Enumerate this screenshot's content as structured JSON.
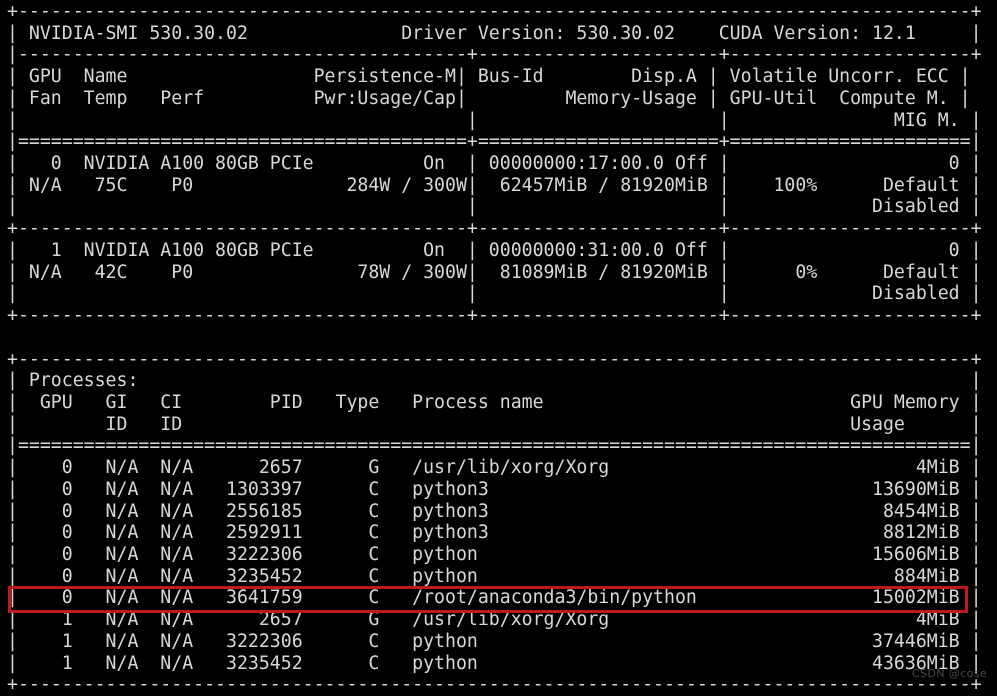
{
  "terminal": {
    "tool": "nvidia-smi",
    "background_color": "#000000",
    "text_color": "#d8d8d8",
    "highlight_color": "#bd1a1a",
    "columns": 80,
    "rows": 32
  },
  "header": {
    "smi_label": "NVIDIA-SMI",
    "smi_version": "530.30.02",
    "driver_label": "Driver Version:",
    "driver_version": "530.30.02",
    "cuda_label": "CUDA Version:",
    "cuda_version": "12.1"
  },
  "gpu_table": {
    "headers_row1": [
      "GPU",
      "Name",
      "Persistence-M",
      "Bus-Id",
      "Disp.A",
      "Volatile Uncorr. ECC"
    ],
    "headers_row2": [
      "Fan",
      "Temp",
      "Perf",
      "Pwr:Usage/Cap",
      "Memory-Usage",
      "GPU-Util",
      "Compute M."
    ],
    "headers_row3": [
      "MIG M."
    ],
    "rows": [
      {
        "index": "0",
        "name": "NVIDIA A100 80GB PCIe",
        "persistence_m": "On",
        "bus_id": "00000000:17:00.0",
        "disp_a": "Off",
        "ecc": "0",
        "fan": "N/A",
        "temp": "75C",
        "perf": "P0",
        "pwr_usage": "284W",
        "pwr_cap": "300W",
        "mem_used": "62457MiB",
        "mem_total": "81920MiB",
        "gpu_util": "100%",
        "compute_m": "Default",
        "mig_m": "Disabled"
      },
      {
        "index": "1",
        "name": "NVIDIA A100 80GB PCIe",
        "persistence_m": "On",
        "bus_id": "00000000:31:00.0",
        "disp_a": "Off",
        "ecc": "0",
        "fan": "N/A",
        "temp": "42C",
        "perf": "P0",
        "pwr_usage": "78W",
        "pwr_cap": "300W",
        "mem_used": "81089MiB",
        "mem_total": "81920MiB",
        "gpu_util": "0%",
        "compute_m": "Default",
        "mig_m": "Disabled"
      }
    ]
  },
  "processes_table": {
    "section_title": "Processes:",
    "headers_row1": [
      "GPU",
      "GI",
      "CI",
      "PID",
      "Type",
      "Process name",
      "GPU Memory"
    ],
    "headers_row2": [
      "ID",
      "ID",
      "Usage"
    ],
    "rows": [
      {
        "gpu": "0",
        "gi": "N/A",
        "ci": "N/A",
        "pid": "2657",
        "type": "G",
        "process_name": "/usr/lib/xorg/Xorg",
        "memory": "4MiB",
        "highlighted": false
      },
      {
        "gpu": "0",
        "gi": "N/A",
        "ci": "N/A",
        "pid": "1303397",
        "type": "C",
        "process_name": "python3",
        "memory": "13690MiB",
        "highlighted": false
      },
      {
        "gpu": "0",
        "gi": "N/A",
        "ci": "N/A",
        "pid": "2556185",
        "type": "C",
        "process_name": "python3",
        "memory": "8454MiB",
        "highlighted": false
      },
      {
        "gpu": "0",
        "gi": "N/A",
        "ci": "N/A",
        "pid": "2592911",
        "type": "C",
        "process_name": "python3",
        "memory": "8812MiB",
        "highlighted": false
      },
      {
        "gpu": "0",
        "gi": "N/A",
        "ci": "N/A",
        "pid": "3222306",
        "type": "C",
        "process_name": "python",
        "memory": "15606MiB",
        "highlighted": false
      },
      {
        "gpu": "0",
        "gi": "N/A",
        "ci": "N/A",
        "pid": "3235452",
        "type": "C",
        "process_name": "python",
        "memory": "884MiB",
        "highlighted": false
      },
      {
        "gpu": "0",
        "gi": "N/A",
        "ci": "N/A",
        "pid": "3641759",
        "type": "C",
        "process_name": "/root/anaconda3/bin/python",
        "memory": "15002MiB",
        "highlighted": true
      },
      {
        "gpu": "1",
        "gi": "N/A",
        "ci": "N/A",
        "pid": "2657",
        "type": "G",
        "process_name": "/usr/lib/xorg/Xorg",
        "memory": "4MiB",
        "highlighted": false
      },
      {
        "gpu": "1",
        "gi": "N/A",
        "ci": "N/A",
        "pid": "3222306",
        "type": "C",
        "process_name": "python",
        "memory": "37446MiB",
        "highlighted": false
      },
      {
        "gpu": "1",
        "gi": "N/A",
        "ci": "N/A",
        "pid": "3235452",
        "type": "C",
        "process_name": "python",
        "memory": "43636MiB",
        "highlighted": false
      }
    ]
  },
  "watermark": {
    "text": "CSDN @cose"
  },
  "raw_lines": [
    "+---------------------------------------------------------------------------------------+",
    "| NVIDIA-SMI 530.30.02              Driver Version: 530.30.02    CUDA Version: 12.1     |",
    "|-----------------------------------------+----------------------+----------------------+",
    "| GPU  Name                 Persistence-M| Bus-Id        Disp.A | Volatile Uncorr. ECC |",
    "| Fan  Temp   Perf          Pwr:Usage/Cap|         Memory-Usage | GPU-Util  Compute M. |",
    "|                                         |                      |               MIG M. |",
    "|=========================================+======================+======================|",
    "|   0  NVIDIA A100 80GB PCIe          On  | 00000000:17:00.0 Off |                    0 |",
    "| N/A   75C    P0              284W / 300W|  62457MiB / 81920MiB |    100%      Default |",
    "|                                         |                      |             Disabled |",
    "+-----------------------------------------+----------------------+----------------------+",
    "|   1  NVIDIA A100 80GB PCIe          On  | 00000000:31:00.0 Off |                    0 |",
    "| N/A   42C    P0               78W / 300W|  81089MiB / 81920MiB |      0%      Default |",
    "|                                         |                      |             Disabled |",
    "+-----------------------------------------+----------------------+----------------------+",
    "",
    "+---------------------------------------------------------------------------------------+",
    "| Processes:                                                                            |",
    "|  GPU   GI   CI        PID   Type   Process name                            GPU Memory |",
    "|        ID   ID                                                             Usage      |",
    "|=======================================================================================|",
    "|    0   N/A  N/A      2657      G   /usr/lib/xorg/Xorg                            4MiB |",
    "|    0   N/A  N/A   1303397      C   python3                                   13690MiB |",
    "|    0   N/A  N/A   2556185      C   python3                                    8454MiB |",
    "|    0   N/A  N/A   2592911      C   python3                                    8812MiB |",
    "|    0   N/A  N/A   3222306      C   python                                    15606MiB |",
    "|    0   N/A  N/A   3235452      C   python                                      884MiB |",
    "|    0   N/A  N/A   3641759      C   /root/anaconda3/bin/python                15002MiB |",
    "|    1   N/A  N/A      2657      G   /usr/lib/xorg/Xorg                            4MiB |",
    "|    1   N/A  N/A   3222306      C   python                                    37446MiB |",
    "|    1   N/A  N/A   3235452      C   python                                    43636MiB |",
    "+---------------------------------------------------------------------------------------+"
  ]
}
